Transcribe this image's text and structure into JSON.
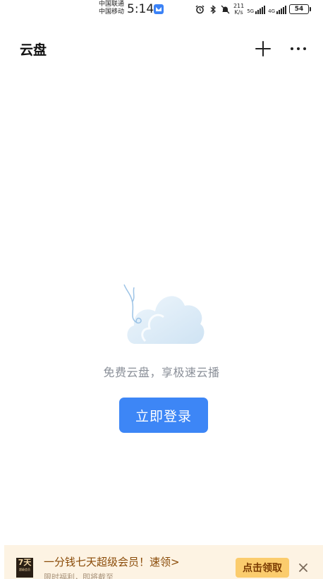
{
  "status_bar": {
    "carrier_1": "中国联通",
    "carrier_2": "中国移动",
    "time": "5:14",
    "speed_value": "211",
    "speed_unit": "K/s",
    "network_1": "5G",
    "network_2": "4G",
    "battery": "54"
  },
  "header": {
    "title": "云盘"
  },
  "empty_state": {
    "message": "免费云盘，享极速云播",
    "login_button_label": "立即登录"
  },
  "promo": {
    "badge_main": "7天",
    "badge_sub": "超级会员",
    "title": "一分钱七天超级会员！速领>",
    "subtitle": "限时福利，即将截至",
    "claim_button_label": "点击领取"
  },
  "colors": {
    "accent": "#3d86f6",
    "promo_background": "#fdf3e3",
    "promo_button": "#fbcc6d"
  }
}
